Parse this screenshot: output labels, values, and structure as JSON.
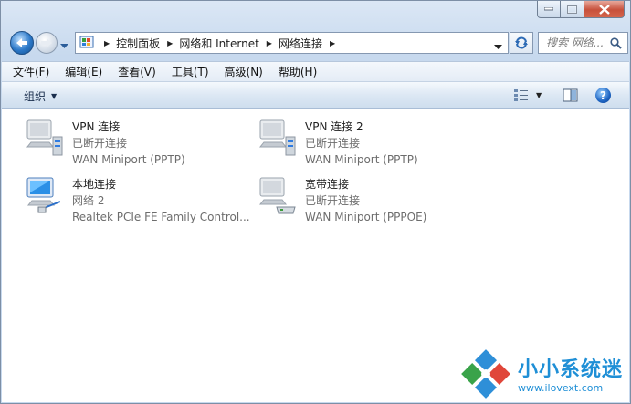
{
  "address": {
    "crumbs": [
      "控制面板",
      "网络和 Internet",
      "网络连接"
    ]
  },
  "search": {
    "placeholder": "搜索 网络..."
  },
  "menu": [
    "文件(F)",
    "编辑(E)",
    "查看(V)",
    "工具(T)",
    "高级(N)",
    "帮助(H)"
  ],
  "toolbar": {
    "organize_label": "组织",
    "help_label": "?"
  },
  "connections": [
    {
      "name": "VPN 连接",
      "status": "已断开连接",
      "device": "WAN Miniport (PPTP)",
      "icon": "vpn-connection-icon"
    },
    {
      "name": "VPN 连接 2",
      "status": "已断开连接",
      "device": "WAN Miniport (PPTP)",
      "icon": "vpn-connection-icon"
    },
    {
      "name": "本地连接",
      "status": "网络  2",
      "device": "Realtek PCIe FE Family Control...",
      "icon": "lan-connection-icon"
    },
    {
      "name": "宽带连接",
      "status": "已断开连接",
      "device": "WAN Miniport (PPPOE)",
      "icon": "broadband-connection-icon"
    }
  ],
  "watermark": {
    "title": "小小系统迷",
    "url": "www.ilovext.com"
  },
  "colors": {
    "accent": "#1f8fd6",
    "status_text": "#6d6d6d"
  }
}
